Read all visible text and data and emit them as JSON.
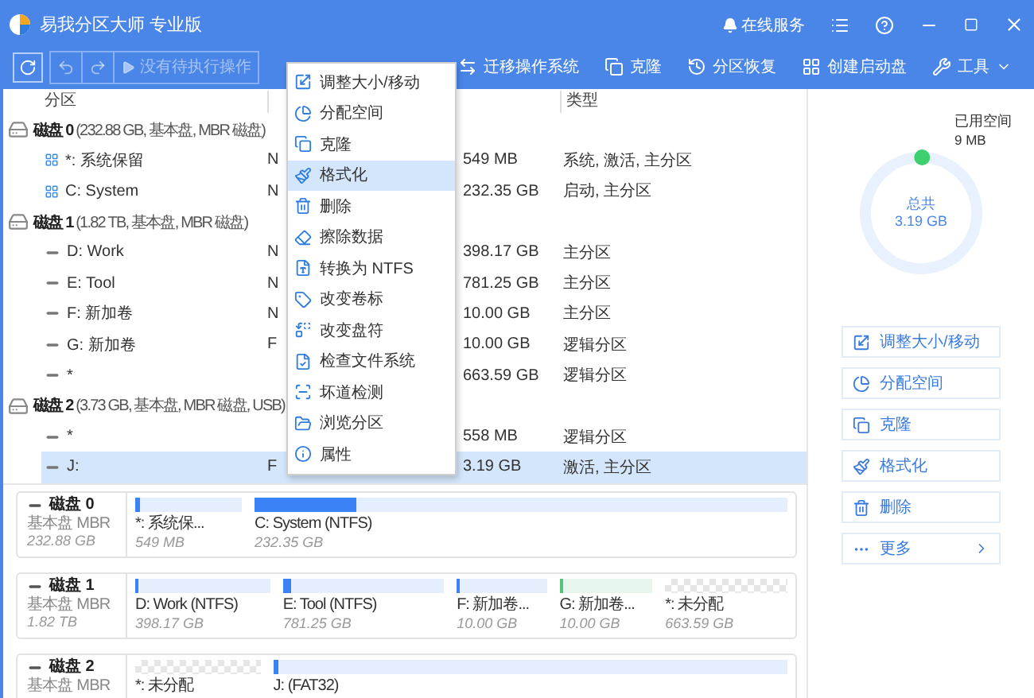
{
  "window": {
    "title": "易我分区大师 专业版",
    "service": "在线服务"
  },
  "toolbar": {
    "pending": "没有待执行操作",
    "actions": [
      "迁移操作系统",
      "克隆",
      "分区恢复",
      "创建启动盘",
      "工具"
    ]
  },
  "table": {
    "header": {
      "partition": "分区",
      "type": "类型"
    },
    "disks": [
      {
        "label": "**磁盘 0** (232.88 GB, 基本盘, MBR 磁盘)",
        "partitions": [
          {
            "name": "*: 系统保留",
            "fs": "N",
            "capacity": "549 MB",
            "type": "系统, 激活, 主分区",
            "system": true,
            "selected": false
          },
          {
            "name": "C: System",
            "fs": "N",
            "capacity": "232.35 GB",
            "type": "启动, 主分区",
            "system": true,
            "selected": false
          }
        ]
      },
      {
        "label": "**磁盘 1** (1.82 TB, 基本盘, MBR 磁盘)",
        "partitions": [
          {
            "name": "D: Work",
            "fs": "N",
            "capacity": "398.17 GB",
            "type": "主分区",
            "system": false,
            "selected": false
          },
          {
            "name": "E: Tool",
            "fs": "N",
            "capacity": "781.25 GB",
            "type": "主分区",
            "system": false,
            "selected": false
          },
          {
            "name": "F: 新加卷",
            "fs": "N",
            "capacity": "10.00 GB",
            "type": "主分区",
            "system": false,
            "selected": false
          },
          {
            "name": "G: 新加卷",
            "fs": "F",
            "capacity": "10.00 GB",
            "type": "逻辑分区",
            "system": false,
            "selected": false
          },
          {
            "name": "*",
            "capacity": "663.59 GB",
            "type": "逻辑分区",
            "system": false,
            "selected": false
          }
        ]
      },
      {
        "label": "**磁盘 2** (3.73 GB, 基本盘, MBR 磁盘, USB)",
        "partitions": [
          {
            "name": "*",
            "capacity": "558 MB",
            "type": "逻辑分区",
            "system": false,
            "selected": false
          },
          {
            "name": "J:",
            "fs": "F",
            "capacity": "3.19 GB",
            "type": "激活, 主分区",
            "system": false,
            "selected": true
          }
        ]
      }
    ]
  },
  "context_menu": [
    {
      "label": "调整大小/移动",
      "selected": false
    },
    {
      "label": "分配空间",
      "selected": false
    },
    {
      "label": "克隆",
      "selected": false
    },
    {
      "label": "格式化",
      "selected": true
    },
    {
      "label": "删除",
      "selected": false
    },
    {
      "label": "擦除数据",
      "selected": false
    },
    {
      "label": "转换为 NTFS",
      "selected": false
    },
    {
      "label": "改变卷标",
      "selected": false
    },
    {
      "label": "改变盘符",
      "selected": false
    },
    {
      "label": "检查文件系统",
      "selected": false
    },
    {
      "label": "坏道检测",
      "selected": false
    },
    {
      "label": "浏览分区",
      "selected": false
    },
    {
      "label": "属性",
      "selected": false
    }
  ],
  "disk_map": [
    {
      "label": "磁盘 0",
      "type": "基本盘 MBR",
      "size": "232.88 GB",
      "partitions": [
        {
          "name": "*: 系统保...",
          "size": "549 MB",
          "kind": "primary",
          "level": 0.04
        },
        {
          "name": "C: System (NTFS)",
          "size": "232.35 GB",
          "kind": "primary",
          "level": 0.19
        }
      ]
    },
    {
      "label": "磁盘 1",
      "type": "基本盘 MBR",
      "size": "1.82 TB",
      "partitions": [
        {
          "name": "D: Work (NTFS)",
          "size": "398.17 GB",
          "kind": "primary",
          "level": 0.02
        },
        {
          "name": "E: Tool (NTFS)",
          "size": "781.25 GB",
          "kind": "primary",
          "level": 0.05
        },
        {
          "name": "F: 新加卷...",
          "size": "10.00 GB",
          "kind": "primary",
          "level": 0.03
        },
        {
          "name": "G: 新加卷...",
          "size": "10.00 GB",
          "kind": "logical",
          "level": 0.03
        },
        {
          "name": "*: 未分配",
          "size": "663.59 GB",
          "kind": "unallocated"
        }
      ]
    },
    {
      "label": "磁盘 2",
      "type": "基本盘 MBR",
      "partitions": [
        {
          "name": "*: 未分配",
          "kind": "unallocated"
        },
        {
          "name": "J:  (FAT32)",
          "kind": "primary",
          "level": 0.01
        }
      ]
    }
  ],
  "details": {
    "used_label": "已用空间",
    "used": "9 MB",
    "total_label": "总共",
    "total": "3.19 GB",
    "level": 0.003,
    "actions": [
      {
        "label": "调整大小/移动",
        "kind": "action"
      },
      {
        "label": "分配空间",
        "kind": "action"
      },
      {
        "label": "克隆",
        "kind": "action"
      },
      {
        "label": "格式化",
        "kind": "action"
      },
      {
        "label": "删除",
        "kind": "action"
      },
      {
        "label": "更多",
        "kind": "more"
      }
    ]
  }
}
